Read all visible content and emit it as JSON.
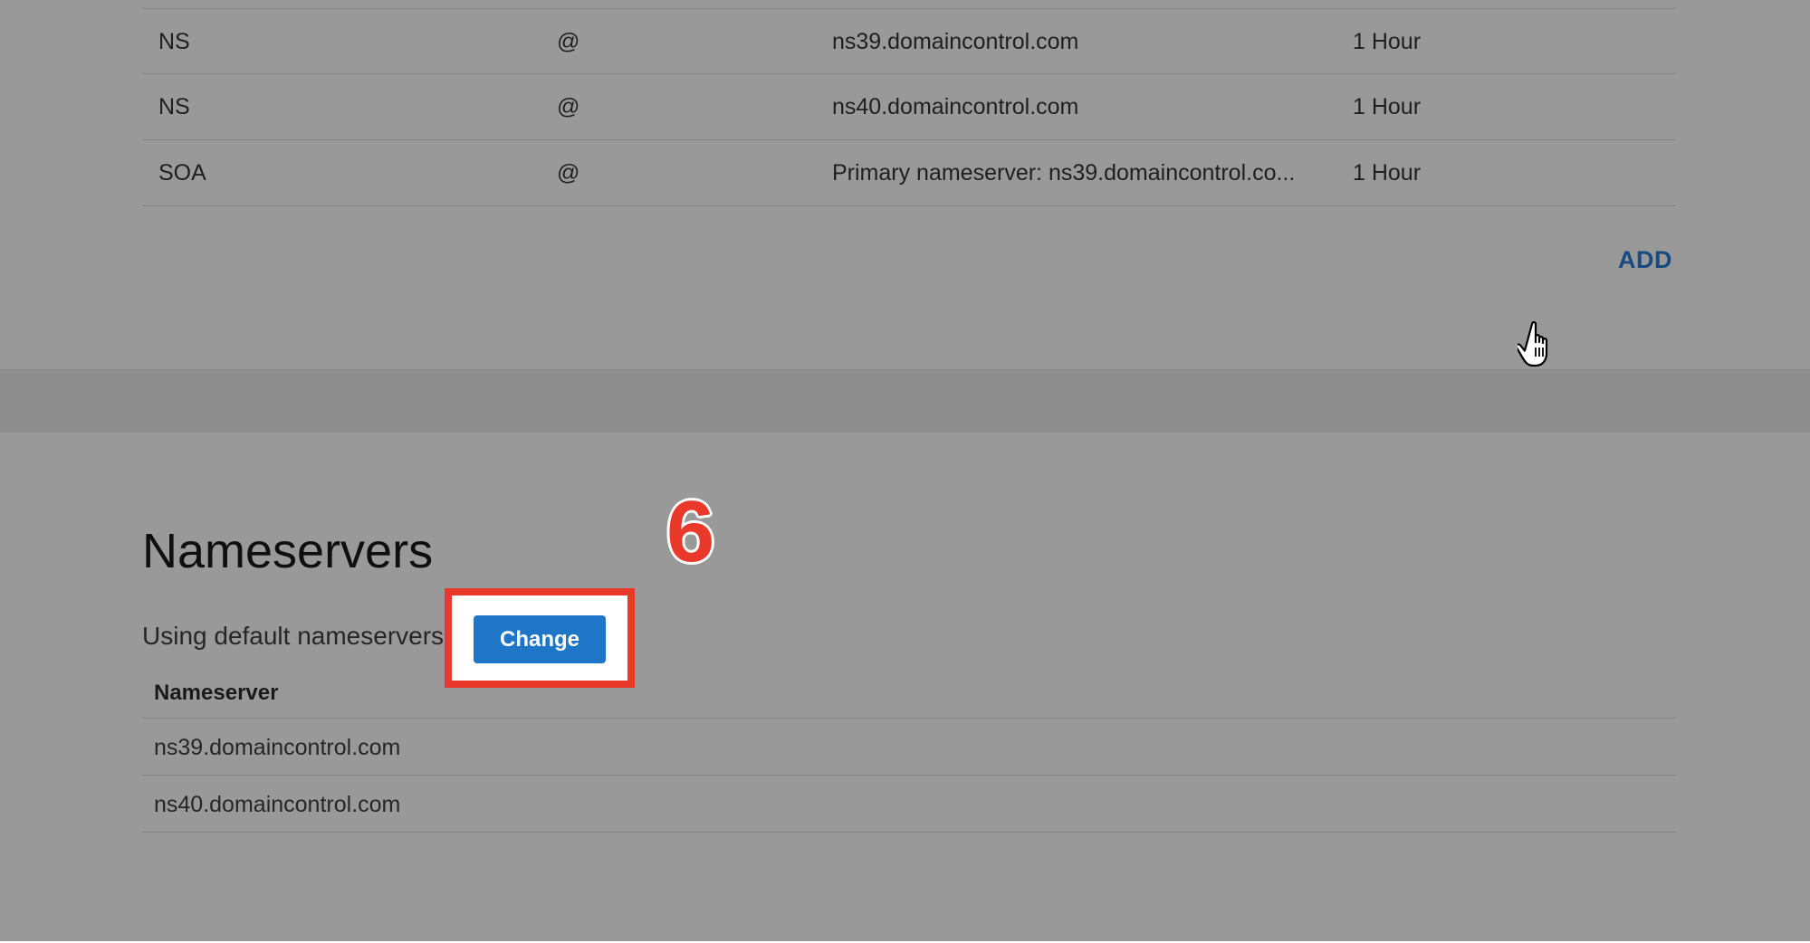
{
  "dns_records": [
    {
      "type": "NS",
      "name": "@",
      "value": "ns39.domaincontrol.com",
      "ttl": "1 Hour"
    },
    {
      "type": "NS",
      "name": "@",
      "value": "ns40.domaincontrol.com",
      "ttl": "1 Hour"
    },
    {
      "type": "SOA",
      "name": "@",
      "value": "Primary nameserver: ns39.domaincontrol.co...",
      "ttl": "1 Hour"
    }
  ],
  "add_label": "ADD",
  "nameservers": {
    "title": "Nameservers",
    "status": "Using default nameservers",
    "change_label": "Change",
    "column_header": "Nameserver",
    "rows": [
      "ns39.domaincontrol.com",
      "ns40.domaincontrol.com"
    ]
  },
  "annotation": {
    "step_number": "6",
    "highlight_color": "#e8392b"
  },
  "colors": {
    "overlay": "#999999",
    "link": "#174a80",
    "button": "#1f76c9"
  },
  "icons": {
    "cursor": "hand-pointer-icon"
  }
}
